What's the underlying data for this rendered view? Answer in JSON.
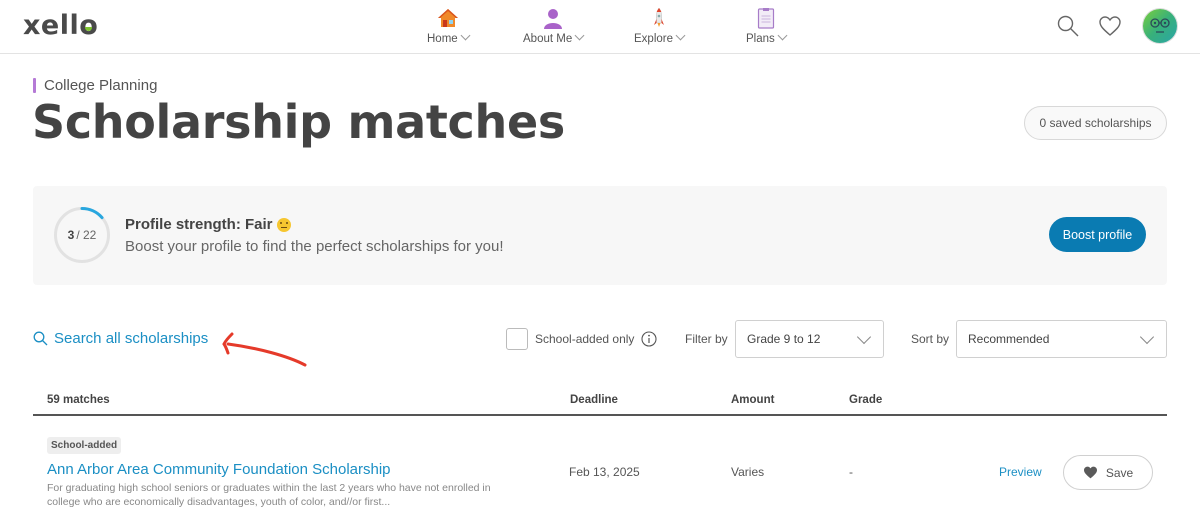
{
  "brand": {
    "name": "xello",
    "accent": "#7cc22e"
  },
  "nav": {
    "items": [
      {
        "label": "Home",
        "icon": "house-icon"
      },
      {
        "label": "About Me",
        "icon": "person-icon"
      },
      {
        "label": "Explore",
        "icon": "rocket-icon"
      },
      {
        "label": "Plans",
        "icon": "clipboard-icon"
      }
    ],
    "right_icons": [
      "search-icon",
      "heart-icon",
      "avatar"
    ]
  },
  "header": {
    "eyebrow": "College Planning",
    "title": "Scholarship matches",
    "saved_button": "0 saved scholarships"
  },
  "profile": {
    "score": "3",
    "total": "/ 22",
    "progress_fraction": 0.136,
    "title": "Profile strength: Fair",
    "emoji": "neutral-face",
    "subtitle": "Boost your profile to find the perfect scholarships for you!",
    "boost_button": "Boost profile",
    "button_color": "#0a7bb2",
    "ring_color": "#29a7df"
  },
  "filters": {
    "search_link": "Search all scholarships",
    "checkbox_label": "School-added only",
    "checkbox_checked": false,
    "filter_label": "Filter by",
    "filter_value": "Grade 9 to 12",
    "sort_label": "Sort by",
    "sort_value": "Recommended"
  },
  "table": {
    "headers": {
      "matches": "59 matches",
      "deadline": "Deadline",
      "amount": "Amount",
      "grade": "Grade"
    },
    "rows": [
      {
        "tag": "School-added",
        "title": "Ann Arbor Area Community Foundation Scholarship",
        "description": "For graduating high school seniors or graduates within the last 2 years who have not enrolled in college who are economically disadvantages, youth of color, and//or first...",
        "deadline": "Feb 13, 2025",
        "amount": "Varies",
        "grade": "-",
        "preview": "Preview",
        "save": "Save"
      }
    ]
  }
}
